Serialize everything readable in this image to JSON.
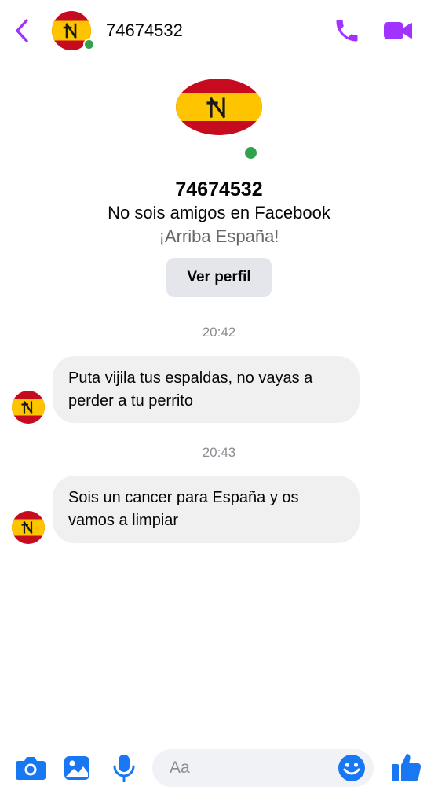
{
  "header": {
    "title": "74674532",
    "icons": {
      "back": "chevron-left-icon",
      "call": "phone-icon",
      "video": "video-camera-icon"
    },
    "accent_color": "#a033ff"
  },
  "profile": {
    "name": "74674532",
    "relation": "No sois amigos en Facebook",
    "bio": "¡Arriba España!",
    "view_profile_label": "Ver perfil",
    "online": true
  },
  "messages": [
    {
      "timestamp": "20:42",
      "text": "Puta vijila tus espaldas, no vayas a perder a tu perrito"
    },
    {
      "timestamp": "20:43",
      "text": "Sois un cancer para España y os vamos a limpiar"
    }
  ],
  "composer": {
    "placeholder": "Aa",
    "icons": [
      "camera-icon",
      "image-icon",
      "microphone-icon",
      "emoji-icon",
      "thumbs-up-icon"
    ],
    "accent_color": "#1877f2"
  },
  "colors": {
    "flag_red": "#c60b1e",
    "flag_yellow": "#ffc400",
    "online_green": "#31a24c"
  }
}
